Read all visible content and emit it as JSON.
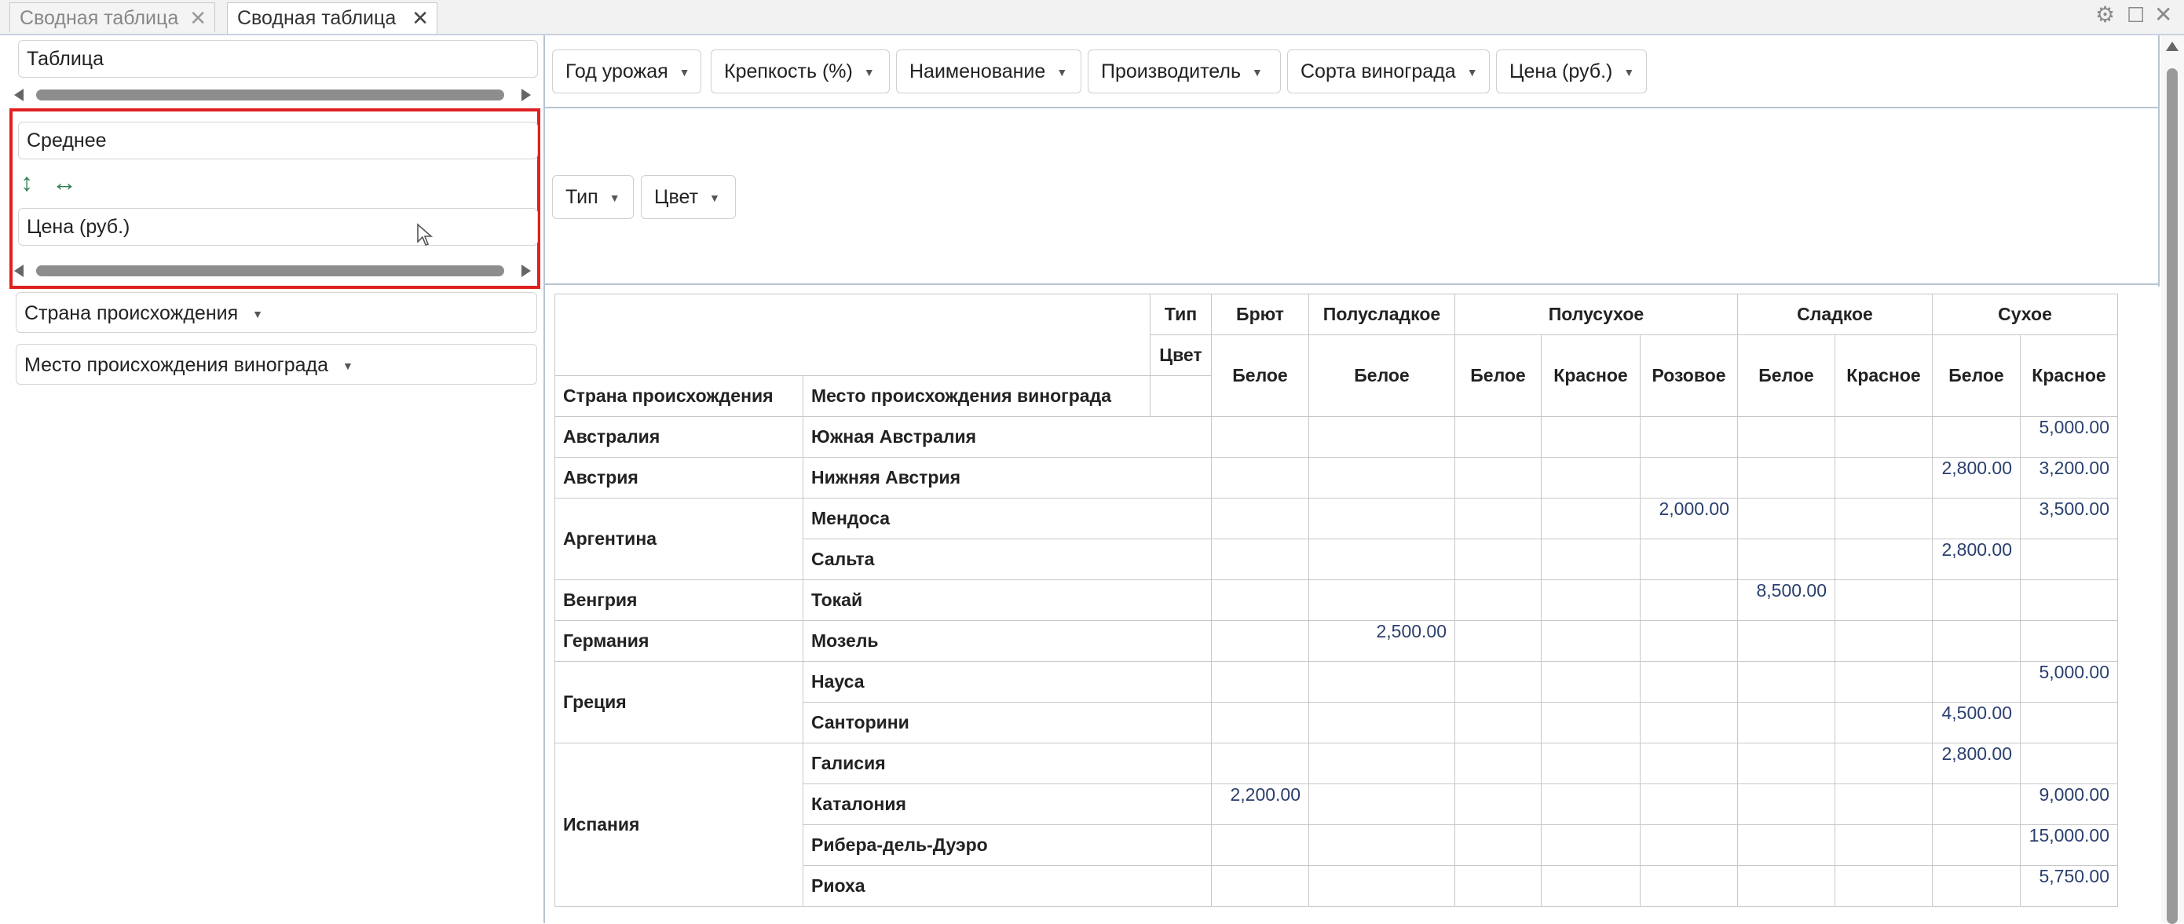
{
  "tabs": [
    {
      "label": "Сводная таблица",
      "active": false
    },
    {
      "label": "Сводная таблица",
      "active": true
    }
  ],
  "window_controls": {
    "settings_icon": "gear-icon",
    "maximize_icon": "maximize-icon",
    "close_icon": "close-icon"
  },
  "left": {
    "render_type": "Таблица",
    "aggregation": "Среднее",
    "value_field": "Цена (руб.)",
    "row_fields": [
      "Страна происхождения",
      "Место происхождения винограда"
    ],
    "icons": {
      "vertical": "↕",
      "horizontal": "↔"
    }
  },
  "unused_fields": [
    "Год урожая",
    "Крепкость (%)",
    "Наименование",
    "Производитель",
    "Сорта винограда",
    "Цена (руб.)"
  ],
  "col_fields": [
    "Тип",
    "Цвет"
  ],
  "pivot": {
    "col_attr_labels": [
      "Тип",
      "Цвет"
    ],
    "row_attr_labels": [
      "Страна происхождения",
      "Место происхождения винограда"
    ],
    "types": [
      {
        "name": "Брют",
        "colors": [
          "Белое"
        ]
      },
      {
        "name": "Полусладкое",
        "colors": [
          "Белое"
        ]
      },
      {
        "name": "Полусухое",
        "colors": [
          "Белое",
          "Красное",
          "Розовое"
        ]
      },
      {
        "name": "Сладкое",
        "colors": [
          "Белое",
          "Красное"
        ]
      },
      {
        "name": "Сухое",
        "colors": [
          "Белое",
          "Красное"
        ]
      }
    ],
    "rows": [
      {
        "country": "Австралия",
        "region": "Южная Австралия",
        "values": [
          "",
          "",
          "",
          "",
          "",
          "",
          "",
          "",
          "5,000.00"
        ]
      },
      {
        "country": "Австрия",
        "region": "Нижняя Австрия",
        "values": [
          "",
          "",
          "",
          "",
          "",
          "",
          "",
          "2,800.00",
          "3,200.00"
        ]
      },
      {
        "country": "Аргентина",
        "region": "Мендоса",
        "values": [
          "",
          "",
          "",
          "",
          "2,000.00",
          "",
          "",
          "",
          "3,500.00"
        ]
      },
      {
        "country": "",
        "region": "Сальта",
        "values": [
          "",
          "",
          "",
          "",
          "",
          "",
          "",
          "2,800.00",
          ""
        ]
      },
      {
        "country": "Венгрия",
        "region": "Токай",
        "values": [
          "",
          "",
          "",
          "",
          "",
          "8,500.00",
          "",
          "",
          ""
        ]
      },
      {
        "country": "Германия",
        "region": "Мозель",
        "values": [
          "",
          "2,500.00",
          "",
          "",
          "",
          "",
          "",
          "",
          ""
        ]
      },
      {
        "country": "Греция",
        "region": "Науса",
        "values": [
          "",
          "",
          "",
          "",
          "",
          "",
          "",
          "",
          "5,000.00"
        ]
      },
      {
        "country": "",
        "region": "Санторини",
        "values": [
          "",
          "",
          "",
          "",
          "",
          "",
          "",
          "4,500.00",
          ""
        ]
      },
      {
        "country": "Испания",
        "region": "Галисия",
        "values": [
          "",
          "",
          "",
          "",
          "",
          "",
          "",
          "2,800.00",
          ""
        ]
      },
      {
        "country": "",
        "region": "Каталония",
        "values": [
          "2,200.00",
          "",
          "",
          "",
          "",
          "",
          "",
          "",
          "9,000.00"
        ]
      },
      {
        "country": "",
        "region": "Рибера-дель-Дуэро",
        "values": [
          "",
          "",
          "",
          "",
          "",
          "",
          "",
          "",
          "15,000.00"
        ]
      },
      {
        "country": "",
        "region": "Риоха",
        "values": [
          "",
          "",
          "",
          "",
          "",
          "",
          "",
          "",
          "5,750.00"
        ]
      }
    ]
  }
}
